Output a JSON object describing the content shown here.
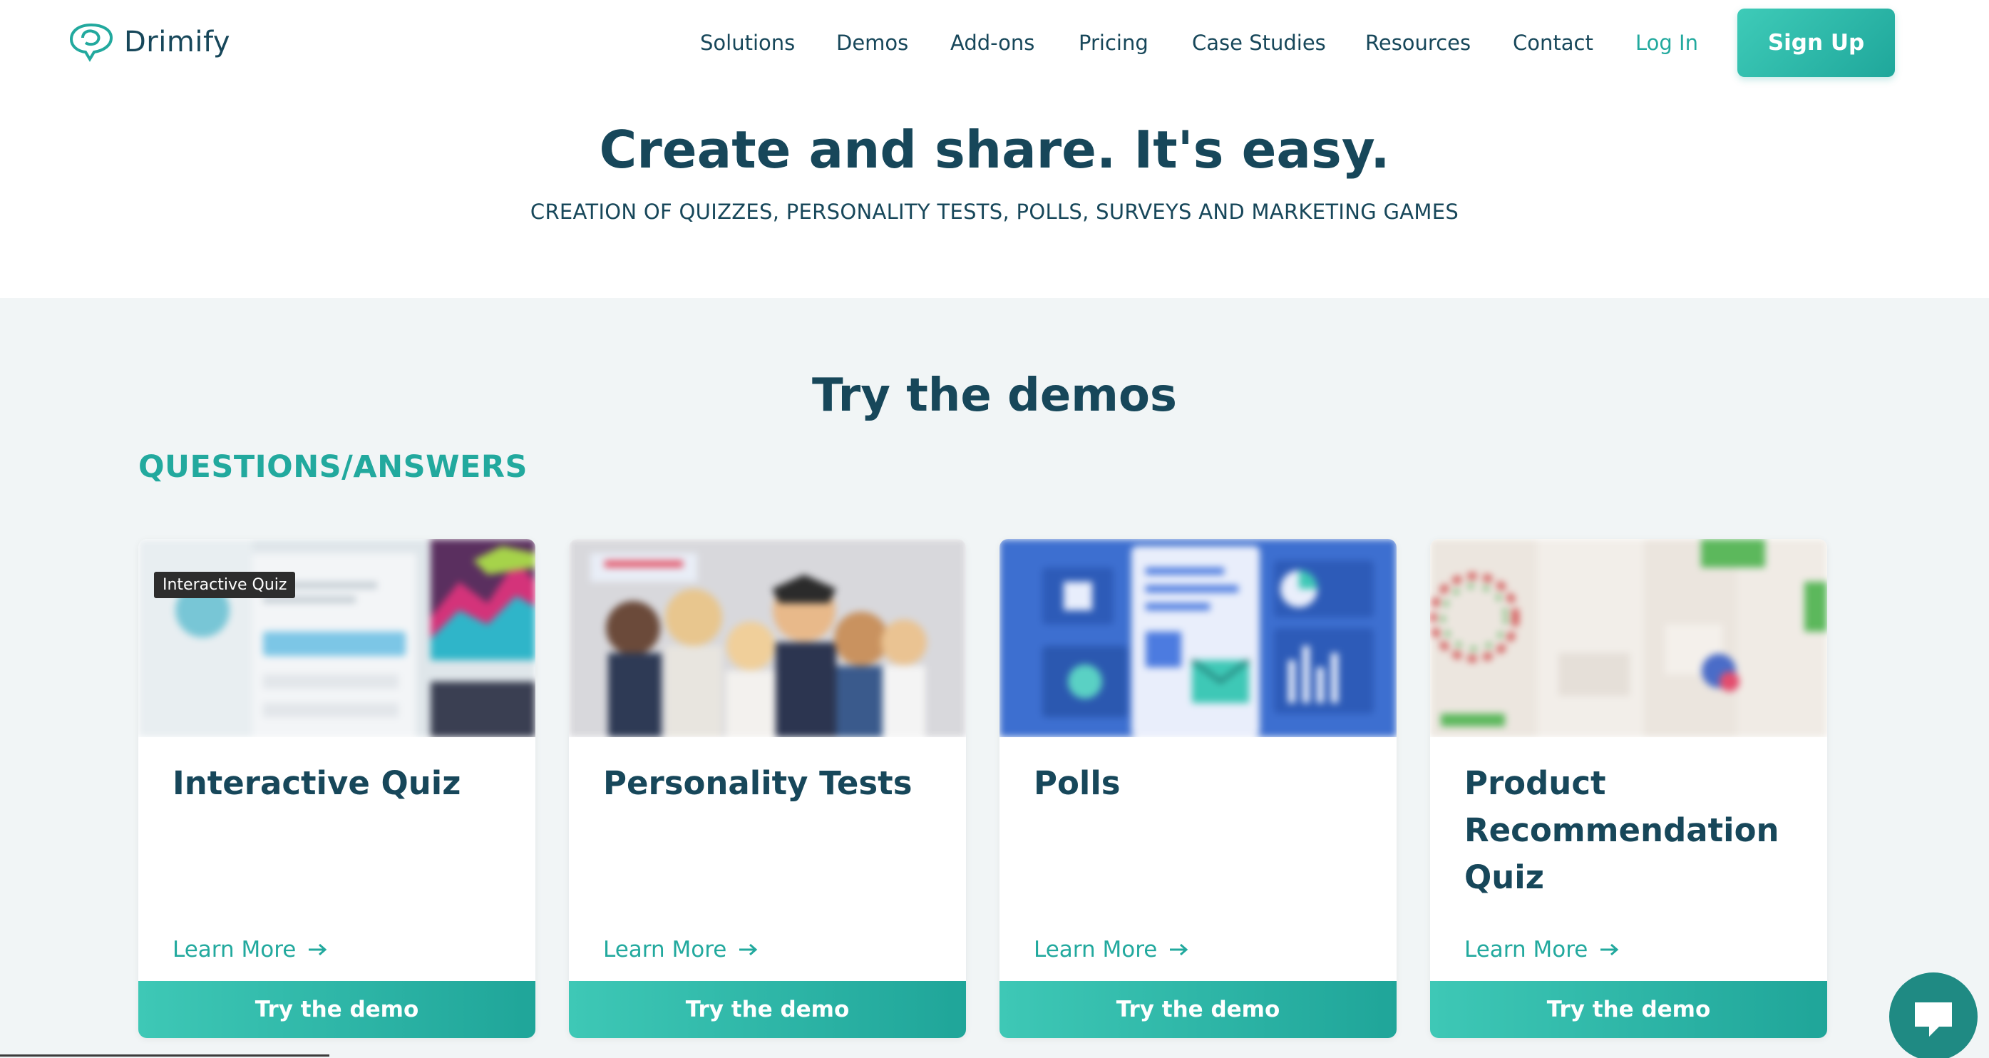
{
  "brand": {
    "name": "Drimify",
    "icon": "drimify-logo-icon",
    "accent": "#22a99e",
    "dark": "#17475a"
  },
  "nav": {
    "items": [
      {
        "label": "Solutions"
      },
      {
        "label": "Demos"
      },
      {
        "label": "Add-ons"
      },
      {
        "label": "Pricing"
      },
      {
        "label": "Case Studies"
      },
      {
        "label": "Resources"
      },
      {
        "label": "Contact"
      }
    ],
    "login": "Log In",
    "signup": "Sign Up"
  },
  "hero": {
    "title": "Create and share. It's easy.",
    "subtitle": "CREATION OF QUIZZES, PERSONALITY TESTS, POLLS, SURVEYS AND MARKETING GAMES"
  },
  "demos": {
    "title": "Try the demos",
    "section": "QUESTIONS/ANSWERS",
    "cards": [
      {
        "badge": "Interactive Quiz",
        "title": "Interactive Quiz",
        "learn": "Learn More",
        "cta": "Try the demo"
      },
      {
        "title": "Personality Tests",
        "learn": "Learn More",
        "cta": "Try the demo"
      },
      {
        "title": "Polls",
        "learn": "Learn More",
        "cta": "Try the demo"
      },
      {
        "title": "Product Recommendation Quiz",
        "learn": "Learn More",
        "cta": "Try the demo"
      }
    ]
  },
  "chat": {
    "icon": "chat-icon"
  }
}
